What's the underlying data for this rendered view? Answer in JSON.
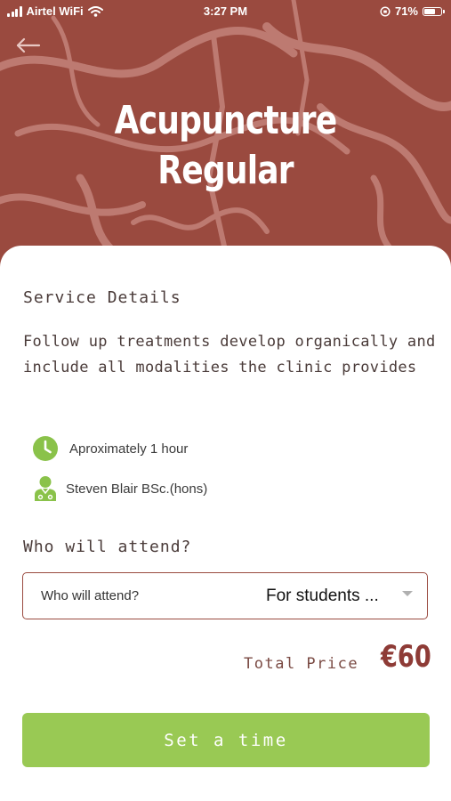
{
  "status_bar": {
    "carrier": "Airtel WiFi",
    "time": "3:27 PM",
    "battery_percent": "71%",
    "battery_level": 0.71,
    "icons": [
      "signal-icon",
      "wifi-icon",
      "orientation-lock-icon",
      "battery-icon"
    ]
  },
  "header": {
    "back_icon": "arrow-left-icon",
    "title_line1": "Acupuncture",
    "title_line2": "Regular",
    "background_color": "#9a4a3f"
  },
  "service_details": {
    "heading": "Service Details",
    "description": "Follow up treatments develop organically and include all modalities the clinic provides",
    "duration_icon": "clock-icon",
    "duration": "Aproximately 1 hour",
    "practitioner_icon": "doctor-icon",
    "practitioner": "Steven Blair BSc.(hons)"
  },
  "attendance": {
    "heading": "Who will attend?",
    "select_label": "Who will attend?",
    "select_value": "For students ..."
  },
  "price": {
    "label": "Total Price",
    "value": "€60"
  },
  "cta": {
    "label": "Set a time",
    "color": "#99c954"
  },
  "colors": {
    "accent": "#9a4a3f",
    "green": "#8ac24a",
    "price": "#8e3b36"
  }
}
